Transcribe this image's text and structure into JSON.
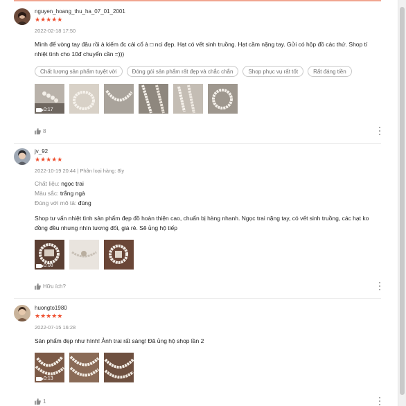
{
  "colors": {
    "accent": "#ee4d2d",
    "muted": "#8c8c8c",
    "tag_border": "#c8c8c8"
  },
  "reviews": [
    {
      "username": "nguyen_hoang_thu_ha_07_01_2001",
      "stars": "★★★★★",
      "meta": "2022-02-18 17:50",
      "text": "Mình để vòng tay đâu rồi à kiếm đc cái cổ à □ nci đẹp. Hạt có vết sinh truồng. Hạt cầm nặng tay. Gửi có hộp đồ các thứ.  Shop tí nhiệt tình cho 10đ chuyển cần =)))",
      "tags": [
        "Chất lượng sản phẩm tuyệt vời",
        "Đóng gói sản phẩm rất đẹp và chắc chắn",
        "Shop phục vụ rất tốt",
        "Rất đáng tiền"
      ],
      "video_duration": "0:17",
      "likes": "8"
    },
    {
      "username": "jv_92",
      "stars": "★★★★★",
      "meta": "2022-10-19 20:44 | Phân loại hàng: 8ly",
      "attributes": [
        {
          "key": "Chất liệu:",
          "value": "ngọc trai"
        },
        {
          "key": "Màu sắc:",
          "value": "trắng ngà"
        },
        {
          "key": "Đúng với mô tả:",
          "value": "đúng"
        }
      ],
      "text": "Shop tư vấn nhiệt tình sản phẩm đẹp đồ hoàn thiện cao, chuẩn bị hàng nhanh. Ngọc trai nặng tay, có vết sinh truồng, các hạt ko đồng đều nhưng nhìn tương đối, giá rẻ. Sẽ ủng hộ tiếp",
      "video_duration": "0:08",
      "likes": "Hữu ích?"
    },
    {
      "username": "huongto1980",
      "stars": "★★★★★",
      "meta": "2022-07-15 16:28",
      "text": "Sản phẩm đẹp như hình! Ảnh trai rất sáng! Đã ủng hộ shop lần 2",
      "video_duration": "0:13",
      "likes": "1"
    }
  ]
}
